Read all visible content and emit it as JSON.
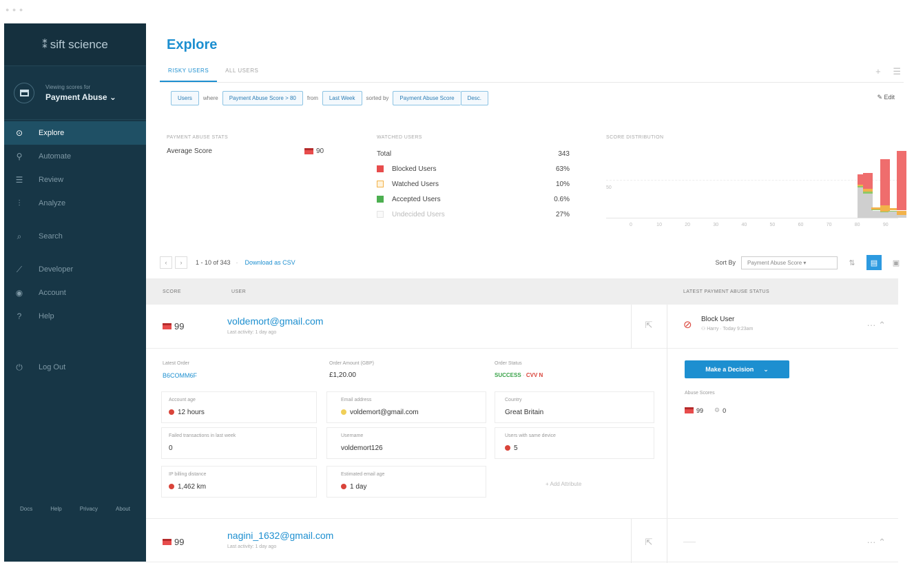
{
  "sidebar": {
    "brand": "sift science",
    "context": {
      "label": "Viewing scores for",
      "value": "Payment Abuse ⌄"
    },
    "items": [
      {
        "icon": "⊙",
        "label": "Explore"
      },
      {
        "icon": "⚲",
        "label": "Automate"
      },
      {
        "icon": "☰",
        "label": "Review"
      },
      {
        "icon": "⫶",
        "label": "Analyze"
      },
      {
        "icon": "⌕",
        "label": "Search"
      },
      {
        "icon": "⟋",
        "label": "Developer"
      },
      {
        "icon": "◉",
        "label": "Account"
      },
      {
        "icon": "?",
        "label": "Help"
      },
      {
        "icon": "⏻",
        "label": "Log Out"
      }
    ],
    "footer_links": [
      "Docs",
      "Help",
      "Privacy",
      "About"
    ]
  },
  "page": {
    "title": "Explore"
  },
  "tabs": [
    "RISKY USERS",
    "ALL USERS"
  ],
  "query": {
    "entity": "Users",
    "where": "where",
    "condition": "Payment Abuse Score > 80",
    "from": "from",
    "period": "Last Week",
    "sorted_by": "sorted by",
    "sort_field": "Payment Abuse Score",
    "sort_dir": "Desc.",
    "edit": "Edit"
  },
  "stats": {
    "title": "PAYMENT ABUSE STATS",
    "average_label": "Average Score",
    "average_value": "90"
  },
  "watched": {
    "title": "WATCHED USERS",
    "total_label": "Total",
    "total_value": "343",
    "rows": [
      {
        "label": "Blocked Users",
        "value": "63%",
        "color": "#e74c4c"
      },
      {
        "label": "Watched Users",
        "value": "10%",
        "color": "#f2b24a"
      },
      {
        "label": "Accepted Users",
        "value": "0.6%",
        "color": "#4caf50"
      },
      {
        "label": "Undecided Users",
        "value": "27%",
        "color": "#dddddd"
      }
    ]
  },
  "chart_data": {
    "type": "bar",
    "title": "SCORE DISTRIBUTION",
    "y_tick": "50",
    "x_ticks": [
      "0",
      "10",
      "20",
      "30",
      "40",
      "50",
      "60",
      "70",
      "80",
      "90"
    ],
    "categories": [
      80,
      82,
      85,
      88,
      91,
      94
    ],
    "series": [
      {
        "name": "Undecided",
        "color": "#cfcfcf",
        "values": [
          42,
          33,
          10,
          8,
          9,
          4
        ]
      },
      {
        "name": "Accepted",
        "color": "#8fc866",
        "values": [
          2,
          3,
          1,
          1,
          1,
          0
        ]
      },
      {
        "name": "Watched",
        "color": "#f2b24a",
        "values": [
          2,
          4,
          3,
          8,
          3,
          6
        ]
      },
      {
        "name": "Blocked",
        "color": "#ef6d6d",
        "values": [
          14,
          22,
          0,
          64,
          0,
          82
        ]
      }
    ],
    "ylim": [
      0,
      100
    ]
  },
  "list": {
    "range": "1 - 10 of 343",
    "sep": "·",
    "download": "Download as CSV",
    "sort_label": "Sort By",
    "sort_value": "Payment Abuse Score"
  },
  "table": {
    "col_score": "SCORE",
    "col_user": "USER",
    "col_status": "LATEST PAYMENT ABUSE STATUS"
  },
  "records": [
    {
      "score": "99",
      "email": "voldemort@gmail.com",
      "activity": "Last activity: 1 day ago",
      "status_title": "Block User",
      "status_sub": "⚇ Harry · Today 9:23am",
      "latest_order_label": "Latest Order",
      "latest_order": "B6COMM6F",
      "amount_label": "Order Amount (GBP)",
      "amount": "£1,20.00",
      "order_status_label": "Order Status",
      "order_status": "SUCCESS",
      "order_status_sep": "·",
      "order_status_flag": "CVV N",
      "fields": [
        {
          "label": "Account age",
          "value": "12 hours",
          "dot": "#d9443a"
        },
        {
          "label": "Email address",
          "value": "voldemort@gmail.com",
          "dot": "#f0cf58"
        },
        {
          "label": "Country",
          "value": "Great Britain",
          "dot": ""
        },
        {
          "label": "Failed transactions in last week",
          "value": "0",
          "dot": ""
        },
        {
          "label": "Username",
          "value": "voldemort126",
          "dot": ""
        },
        {
          "label": "Users with same device",
          "value": "5",
          "dot": "#d9443a"
        },
        {
          "label": "IP billing distance",
          "value": "1,462 km",
          "dot": "#d9443a"
        },
        {
          "label": "Estimated email age",
          "value": "1 day",
          "dot": "#d9443a"
        }
      ],
      "add_attr": "+ Add Attribute",
      "decision": "Make a Decision",
      "abuse_scores_label": "Abuse Scores",
      "abuse_score_payment": "99",
      "abuse_score_other": "0"
    },
    {
      "score": "99",
      "email": "nagini_1632@gmail.com",
      "activity": "Last activity: 1 day ago",
      "status_title": "——"
    }
  ]
}
